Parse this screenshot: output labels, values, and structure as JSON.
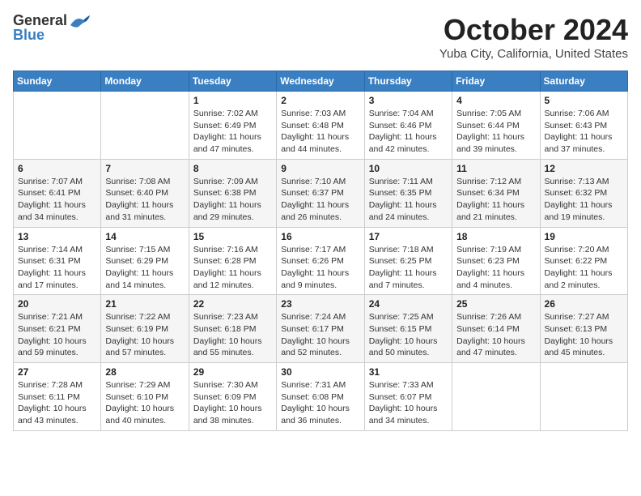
{
  "header": {
    "logo_line1": "General",
    "logo_line2": "Blue",
    "title": "October 2024",
    "location": "Yuba City, California, United States"
  },
  "weekdays": [
    "Sunday",
    "Monday",
    "Tuesday",
    "Wednesday",
    "Thursday",
    "Friday",
    "Saturday"
  ],
  "weeks": [
    [
      {
        "day": "",
        "info": ""
      },
      {
        "day": "",
        "info": ""
      },
      {
        "day": "1",
        "info": "Sunrise: 7:02 AM\nSunset: 6:49 PM\nDaylight: 11 hours and 47 minutes."
      },
      {
        "day": "2",
        "info": "Sunrise: 7:03 AM\nSunset: 6:48 PM\nDaylight: 11 hours and 44 minutes."
      },
      {
        "day": "3",
        "info": "Sunrise: 7:04 AM\nSunset: 6:46 PM\nDaylight: 11 hours and 42 minutes."
      },
      {
        "day": "4",
        "info": "Sunrise: 7:05 AM\nSunset: 6:44 PM\nDaylight: 11 hours and 39 minutes."
      },
      {
        "day": "5",
        "info": "Sunrise: 7:06 AM\nSunset: 6:43 PM\nDaylight: 11 hours and 37 minutes."
      }
    ],
    [
      {
        "day": "6",
        "info": "Sunrise: 7:07 AM\nSunset: 6:41 PM\nDaylight: 11 hours and 34 minutes."
      },
      {
        "day": "7",
        "info": "Sunrise: 7:08 AM\nSunset: 6:40 PM\nDaylight: 11 hours and 31 minutes."
      },
      {
        "day": "8",
        "info": "Sunrise: 7:09 AM\nSunset: 6:38 PM\nDaylight: 11 hours and 29 minutes."
      },
      {
        "day": "9",
        "info": "Sunrise: 7:10 AM\nSunset: 6:37 PM\nDaylight: 11 hours and 26 minutes."
      },
      {
        "day": "10",
        "info": "Sunrise: 7:11 AM\nSunset: 6:35 PM\nDaylight: 11 hours and 24 minutes."
      },
      {
        "day": "11",
        "info": "Sunrise: 7:12 AM\nSunset: 6:34 PM\nDaylight: 11 hours and 21 minutes."
      },
      {
        "day": "12",
        "info": "Sunrise: 7:13 AM\nSunset: 6:32 PM\nDaylight: 11 hours and 19 minutes."
      }
    ],
    [
      {
        "day": "13",
        "info": "Sunrise: 7:14 AM\nSunset: 6:31 PM\nDaylight: 11 hours and 17 minutes."
      },
      {
        "day": "14",
        "info": "Sunrise: 7:15 AM\nSunset: 6:29 PM\nDaylight: 11 hours and 14 minutes."
      },
      {
        "day": "15",
        "info": "Sunrise: 7:16 AM\nSunset: 6:28 PM\nDaylight: 11 hours and 12 minutes."
      },
      {
        "day": "16",
        "info": "Sunrise: 7:17 AM\nSunset: 6:26 PM\nDaylight: 11 hours and 9 minutes."
      },
      {
        "day": "17",
        "info": "Sunrise: 7:18 AM\nSunset: 6:25 PM\nDaylight: 11 hours and 7 minutes."
      },
      {
        "day": "18",
        "info": "Sunrise: 7:19 AM\nSunset: 6:23 PM\nDaylight: 11 hours and 4 minutes."
      },
      {
        "day": "19",
        "info": "Sunrise: 7:20 AM\nSunset: 6:22 PM\nDaylight: 11 hours and 2 minutes."
      }
    ],
    [
      {
        "day": "20",
        "info": "Sunrise: 7:21 AM\nSunset: 6:21 PM\nDaylight: 10 hours and 59 minutes."
      },
      {
        "day": "21",
        "info": "Sunrise: 7:22 AM\nSunset: 6:19 PM\nDaylight: 10 hours and 57 minutes."
      },
      {
        "day": "22",
        "info": "Sunrise: 7:23 AM\nSunset: 6:18 PM\nDaylight: 10 hours and 55 minutes."
      },
      {
        "day": "23",
        "info": "Sunrise: 7:24 AM\nSunset: 6:17 PM\nDaylight: 10 hours and 52 minutes."
      },
      {
        "day": "24",
        "info": "Sunrise: 7:25 AM\nSunset: 6:15 PM\nDaylight: 10 hours and 50 minutes."
      },
      {
        "day": "25",
        "info": "Sunrise: 7:26 AM\nSunset: 6:14 PM\nDaylight: 10 hours and 47 minutes."
      },
      {
        "day": "26",
        "info": "Sunrise: 7:27 AM\nSunset: 6:13 PM\nDaylight: 10 hours and 45 minutes."
      }
    ],
    [
      {
        "day": "27",
        "info": "Sunrise: 7:28 AM\nSunset: 6:11 PM\nDaylight: 10 hours and 43 minutes."
      },
      {
        "day": "28",
        "info": "Sunrise: 7:29 AM\nSunset: 6:10 PM\nDaylight: 10 hours and 40 minutes."
      },
      {
        "day": "29",
        "info": "Sunrise: 7:30 AM\nSunset: 6:09 PM\nDaylight: 10 hours and 38 minutes."
      },
      {
        "day": "30",
        "info": "Sunrise: 7:31 AM\nSunset: 6:08 PM\nDaylight: 10 hours and 36 minutes."
      },
      {
        "day": "31",
        "info": "Sunrise: 7:33 AM\nSunset: 6:07 PM\nDaylight: 10 hours and 34 minutes."
      },
      {
        "day": "",
        "info": ""
      },
      {
        "day": "",
        "info": ""
      }
    ]
  ]
}
